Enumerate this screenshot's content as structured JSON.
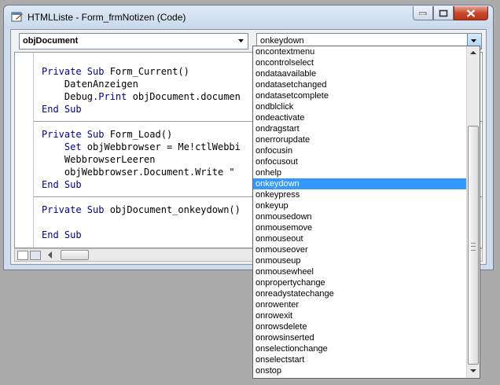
{
  "window": {
    "title": "HTMLListe - Form_frmNotizen (Code)"
  },
  "object_combo": {
    "value": "objDocument"
  },
  "procedure_combo": {
    "value": "onkeydown"
  },
  "code": {
    "blocks": [
      [
        [
          {
            "t": "Private Sub ",
            "k": true
          },
          {
            "t": "Form_Current()",
            "k": false
          }
        ],
        [
          {
            "t": "    DatenAnzeigen",
            "k": false
          }
        ],
        [
          {
            "t": "    Debug",
            "k": false
          },
          {
            "t": ".Print",
            "k": true
          },
          {
            "t": " objDocument.documen",
            "k": false
          }
        ],
        [
          {
            "t": "End Sub",
            "k": true
          }
        ]
      ],
      [
        [
          {
            "t": "Private Sub ",
            "k": true
          },
          {
            "t": "Form_Load()",
            "k": false
          }
        ],
        [
          {
            "t": "    Set ",
            "k": true
          },
          {
            "t": "objWebbrowser = Me!ctlWebbi",
            "k": false
          }
        ],
        [
          {
            "t": "    WebbrowserLeeren",
            "k": false
          }
        ],
        [
          {
            "t": "    objWebbrowser.Document.Write \"",
            "k": false
          }
        ],
        [
          {
            "t": "End Sub",
            "k": true
          }
        ]
      ],
      [
        [
          {
            "t": "Private Sub ",
            "k": true
          },
          {
            "t": "objDocument_onkeydown()",
            "k": false
          }
        ],
        [
          {
            "t": "",
            "k": false
          }
        ],
        [
          {
            "t": "End Sub",
            "k": true
          }
        ]
      ]
    ]
  },
  "dropdown": {
    "selected": "onkeydown",
    "items": [
      "oncontextmenu",
      "oncontrolselect",
      "ondataavailable",
      "ondatasetchanged",
      "ondatasetcomplete",
      "ondblclick",
      "ondeactivate",
      "ondragstart",
      "onerrorupdate",
      "onfocusin",
      "onfocusout",
      "onhelp",
      "onkeydown",
      "onkeypress",
      "onkeyup",
      "onmousedown",
      "onmousemove",
      "onmouseout",
      "onmouseover",
      "onmouseup",
      "onmousewheel",
      "onpropertychange",
      "onreadystatechange",
      "onrowenter",
      "onrowexit",
      "onrowsdelete",
      "onrowsinserted",
      "onselectionchange",
      "onselectstart",
      "onstop"
    ]
  },
  "colors": {
    "keyword": "#00008b",
    "selection": "#3399ff"
  }
}
